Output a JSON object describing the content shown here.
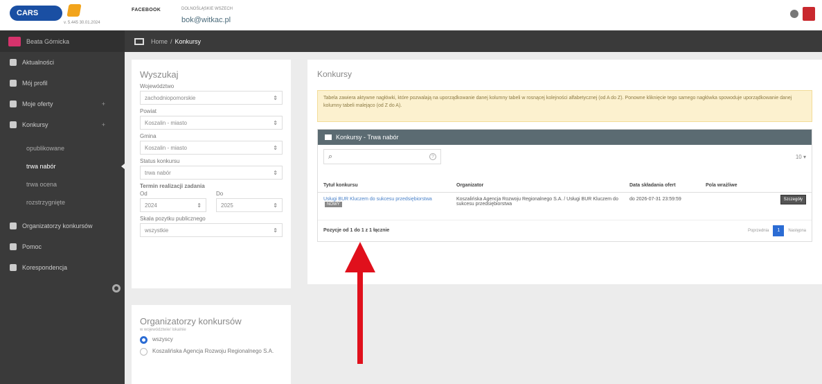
{
  "header": {
    "logo_text": "CARS",
    "version": "v. 5.445 30.01.2024",
    "contact_label": "FACEBOOK",
    "contact_sub": "DOLNOŚLĄSKIE WSZECH",
    "email": "bok@witkac.pl"
  },
  "sidebar": {
    "user": "Beata Górnicka",
    "items": [
      {
        "label": "Aktualności",
        "has_plus": false
      },
      {
        "label": "Mój profil",
        "has_plus": false
      },
      {
        "label": "Moje oferty",
        "has_plus": true
      },
      {
        "label": "Konkursy",
        "has_plus": true
      }
    ],
    "plus": "+",
    "sub_items": [
      "opublikowane",
      "trwa nabór",
      "trwa ocena",
      "rozstrzygnięte"
    ],
    "active_sub": "trwa nabór",
    "bottom_items": [
      "Organizatorzy konkursów",
      "Pomoc",
      "Korespondencja"
    ]
  },
  "breadcrumb": {
    "home": "Home",
    "separator": "/",
    "current": "Konkursy"
  },
  "filter": {
    "title": "Wyszukaj",
    "fields": [
      {
        "label": "Województwo",
        "value": "zachodniopomorskie"
      },
      {
        "label": "Powiat",
        "value": "Koszalin - miasto"
      },
      {
        "label": "Gmina",
        "value": "Koszalin - miasto"
      },
      {
        "label": "Status konkursu",
        "value": "trwa nabór"
      }
    ],
    "term_label": "Termin realizacji zadania",
    "from_label": "Od",
    "to_label": "Do",
    "from_value": "2024",
    "to_value": "2025",
    "scale_label": "Skala pozytku publicznego",
    "scale_value": "wszystkie"
  },
  "organizers": {
    "title": "Organizatorzy konkursów",
    "subtitle": "w województwie/ lokalnie",
    "options": [
      {
        "label": "wszyscy",
        "checked": true
      },
      {
        "label": "Koszalińska Agencja Rozwoju Regionalnego S.A.",
        "checked": false
      }
    ]
  },
  "main": {
    "title": "Konkursy",
    "alert": "Tabela zawiera aktywne nagłówki, które pozwalają na uporządkowanie danej kolumny tabeli w rosnącej kolejności alfabetycznej (od A do Z). Ponowne kliknięcie tego samego nagłówka spowoduje uporządkowanie danej kolumny tabeli malejąco (od Z do A).",
    "table_title": "Konkursy - Trwa nabór",
    "page_size": "10",
    "columns": [
      "Tytuł konkursu",
      "Organizator",
      "Data składania ofert",
      "Pola wrażliwe",
      ""
    ],
    "rows": [
      {
        "title": "Usługi BUR Kluczem do sukcesu przedsiębiorstwa",
        "tag": "NOWY",
        "organizer": "Koszalińska Agencja Rozwoju Regionalnego S.A. / Usługi BUR Kluczem do sukcesu przedsiębiorstwa",
        "date": "do 2026-07-31 23:59:59",
        "action": "Szczegóły"
      }
    ],
    "summary": "Pozycje od 1 do 1 z 1 łącznie",
    "pager": {
      "prev": "Poprzednia",
      "current": "1",
      "next": "Następna"
    }
  },
  "colors": {
    "accent": "#2b6cd4",
    "sidebar": "#3a3a3a",
    "alert_bg": "#fcf1cf",
    "arrow": "#e0101c"
  }
}
